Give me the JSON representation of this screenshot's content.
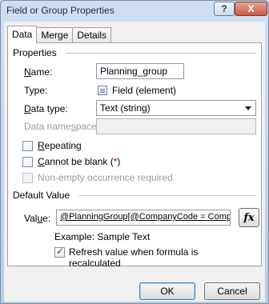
{
  "window": {
    "title": "Field or Group Properties",
    "help_glyph": "?",
    "close_glyph": "X"
  },
  "tabs": [
    {
      "label": "Data",
      "active": true
    },
    {
      "label": "Merge",
      "active": false
    },
    {
      "label": "Details",
      "active": false
    }
  ],
  "properties": {
    "section_title": "Properties",
    "name_label_u": "N",
    "name_label_rest": "ame:",
    "name_value": "Planning_group",
    "type_label": "Type:",
    "type_value": "Field (element)",
    "data_type_label_u": "D",
    "data_type_label_rest": "ata type:",
    "data_type_value": "Text (string)",
    "namespace_label_a": "Data name",
    "namespace_label_u": "s",
    "namespace_label_b": "pace:",
    "namespace_value": ""
  },
  "options": {
    "repeating_u": "R",
    "repeating_rest": "epeating",
    "cannot_blank_u": "C",
    "cannot_blank_rest": "annot be blank (",
    "cannot_blank_star": "*",
    "cannot_blank_close": ")",
    "nonempty": "Non-empty occurrence required"
  },
  "default_value": {
    "section_title": "Default Value",
    "value_label_a": "Val",
    "value_label_u": "u",
    "value_label_b": "e:",
    "value": "@PlanningGroup[@CompanyCode = Compan",
    "fx_label": "fx",
    "example_text": "Example: Sample Text",
    "refresh_line1": "Refresh value when formula is",
    "refresh_line2": "recalculated"
  },
  "buttons": {
    "ok": "OK",
    "cancel": "Cancel"
  }
}
